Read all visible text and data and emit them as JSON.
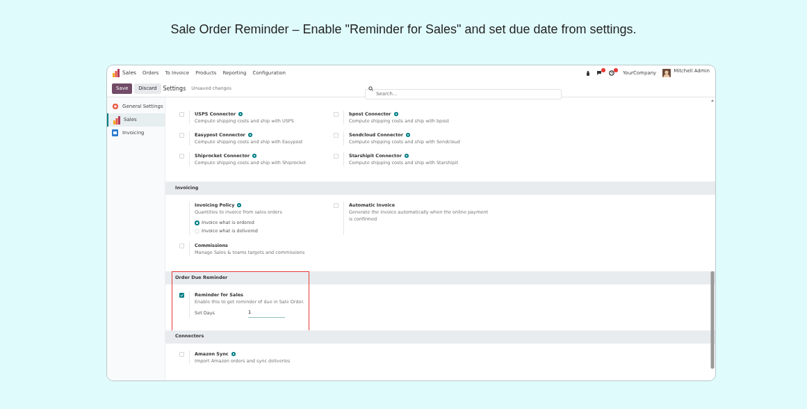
{
  "caption": "Sale Order Reminder – Enable \"Reminder for Sales\" and set due date from settings.",
  "navbar": {
    "app": "Sales",
    "menu": [
      "Orders",
      "To Invoice",
      "Products",
      "Reporting",
      "Configuration"
    ],
    "company": "YourCompany",
    "user": "Mitchell Admin"
  },
  "control_bar": {
    "buttons": [
      {
        "label": "Save",
        "kind": "primary"
      },
      {
        "label": "Discard",
        "kind": "secondary"
      }
    ],
    "breadcrumb": "Settings",
    "status": "Unsaved changes",
    "search": {
      "placeholder": "Search..."
    }
  },
  "sidebar": {
    "items": [
      {
        "label": "General Settings",
        "selected": false
      },
      {
        "label": "Sales",
        "selected": true
      },
      {
        "label": "Invoicing",
        "selected": false
      }
    ]
  },
  "sections": [
    {
      "settings": [
        {
          "kind": "checkbox",
          "label": "USPS Connector",
          "description": "Compute shipping costs and ship with USPS",
          "checked": false,
          "help": true
        },
        {
          "kind": "checkbox",
          "label": "bpost Connector",
          "description": "Compute shipping costs and ship with bpost",
          "checked": false,
          "help": true
        },
        {
          "kind": "checkbox",
          "label": "Easypost Connector",
          "description": "Compute shipping costs and ship with Easypost",
          "checked": false,
          "help": true
        },
        {
          "kind": "checkbox",
          "label": "Sendcloud Connector",
          "description": "Compute shipping costs and ship with Sendcloud",
          "checked": false,
          "help": true
        },
        {
          "kind": "checkbox",
          "label": "Shiprocket Connector",
          "description": "Compute shipping costs and ship with Shiprocket",
          "checked": false,
          "help": true
        },
        {
          "kind": "checkbox",
          "label": "Starshipit Connector",
          "description": "Compute shipping costs and ship with Starshipit",
          "checked": false,
          "help": true
        }
      ]
    },
    {
      "title": "Invoicing",
      "settings": [
        {
          "kind": "radio_group",
          "label": "Invoicing Policy",
          "description": "Quantities to invoice from sales orders",
          "help": true,
          "options": [
            {
              "label": "Invoice what is ordered",
              "selected": true
            },
            {
              "label": "Invoice what is delivered",
              "selected": false
            }
          ]
        },
        {
          "kind": "checkbox",
          "label": "Automatic Invoice",
          "description": "Generate the invoice automatically when the online payment is confirmed",
          "checked": false,
          "help": false
        },
        {
          "kind": "checkbox",
          "label": "Commissions",
          "description": "Manage Sales & teams targets and commissions",
          "checked": false,
          "help": false
        }
      ]
    },
    {
      "title": "Order Due Reminder",
      "highlighted": true,
      "settings": [
        {
          "kind": "checkbox",
          "label": "Reminder for Sales",
          "description": "Enable this to get reminder of due in Sale Order.",
          "checked": true,
          "help": false,
          "field": {
            "label": "Set Days",
            "value": "1"
          }
        }
      ]
    },
    {
      "title": "Connectors",
      "settings": [
        {
          "kind": "checkbox",
          "label": "Amazon Sync",
          "description": "Import Amazon orders and sync deliveries",
          "checked": false,
          "help": true
        }
      ]
    }
  ]
}
